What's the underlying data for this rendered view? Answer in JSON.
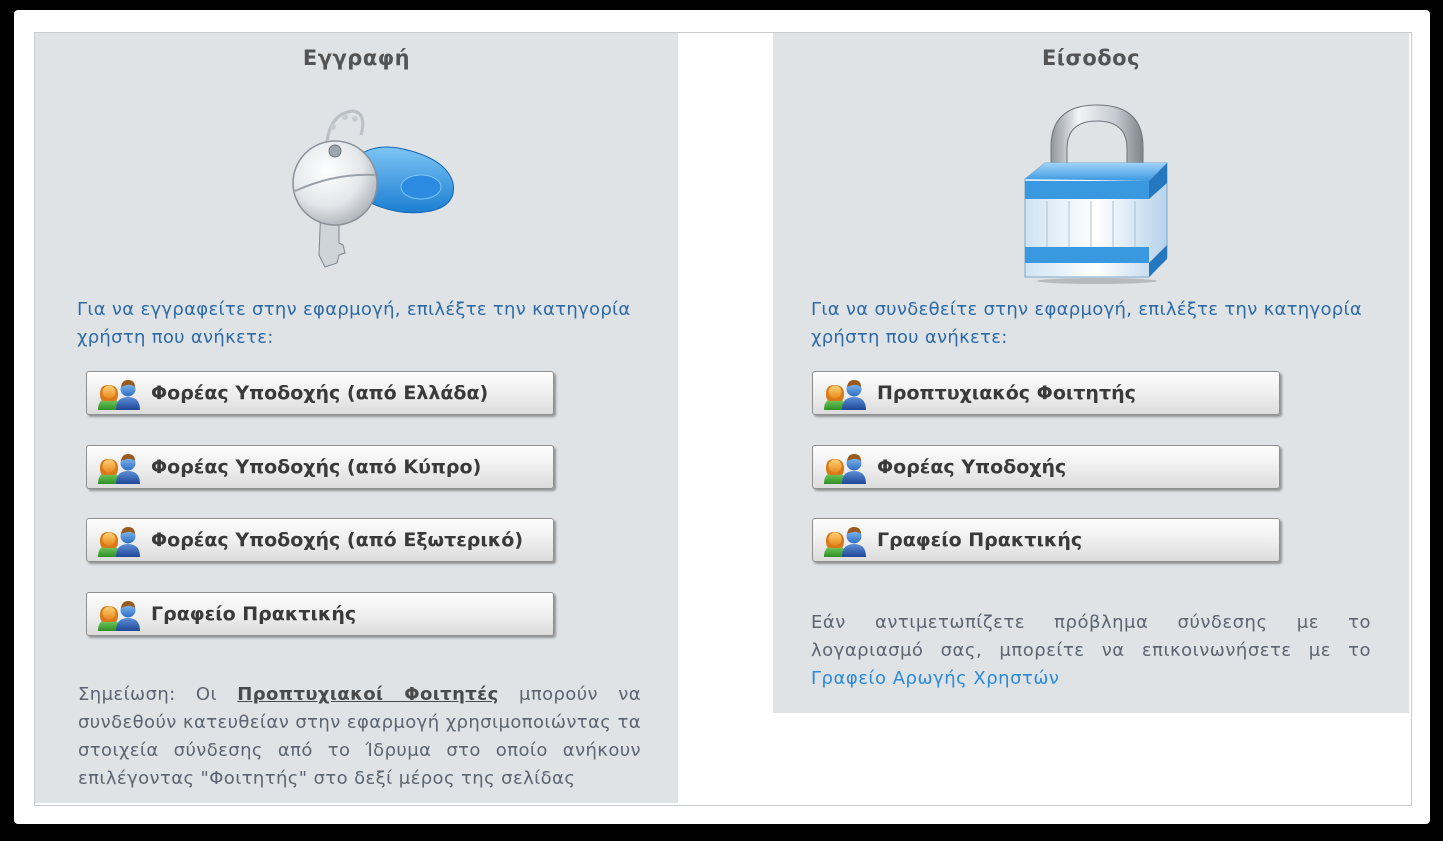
{
  "register": {
    "title": "Εγγραφή",
    "intro": "Για να εγγραφείτε στην εφαρμογή, επιλέξτε την κατηγορία χρήστη που ανήκετε:",
    "buttons": [
      {
        "label": "Φορέας Υποδοχής (από Ελλάδα)",
        "icon": "users-icon"
      },
      {
        "label": "Φορέας Υποδοχής (από Κύπρο)",
        "icon": "users-icon"
      },
      {
        "label": "Φορέας Υποδοχής (από Εξωτερικό)",
        "icon": "users-icon"
      },
      {
        "label": "Γραφείο Πρακτικής",
        "icon": "users-icon"
      }
    ],
    "note_prefix": "Σημείωση: Οι",
    "note_link": "Προπτυχιακοί Φοιτητές",
    "note_suffix": "μπορούν να συνδεθούν κατευθείαν στην εφαρμογή χρησιμοποιώντας τα στοιχεία σύνδεσης από το Ίδρυμα στο οποίο ανήκουν επιλέγοντας \"Φοιτητής\" στο δεξί μέρος της σελίδας",
    "illustration": "key-icon"
  },
  "login": {
    "title": "Είσοδος",
    "intro": "Για να συνδεθείτε στην εφαρμογή, επιλέξτε την κατηγορία χρήστη που ανήκετε:",
    "buttons": [
      {
        "label": "Προπτυχιακός Φοιτητής",
        "icon": "users-icon"
      },
      {
        "label": "Φορέας Υποδοχής",
        "icon": "users-icon"
      },
      {
        "label": "Γραφείο Πρακτικής",
        "icon": "users-icon"
      }
    ],
    "help_text": "Εάν αντιμετωπίζετε πρόβλημα σύνδεσης με το λογαριασμό σας, μπορείτε να επικοινωνήσετε με το",
    "help_link": "Γραφείο Αρωγής Χρηστών",
    "illustration": "padlock-icon"
  },
  "colors": {
    "panel_bg": "#dfe3e6",
    "intro_text": "#2d6aa6",
    "link": "#2b8ad8",
    "accent_blue": "#3a9ee4"
  }
}
